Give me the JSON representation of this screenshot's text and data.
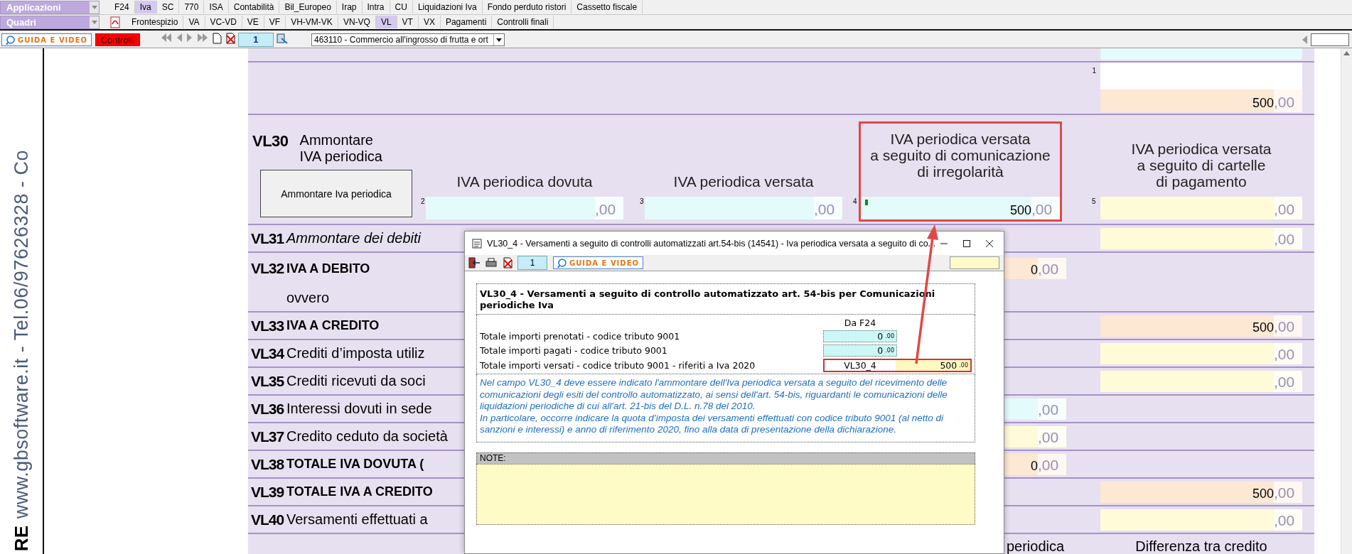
{
  "menu_bar": {
    "dropdown": "Applicazioni",
    "tabs": [
      {
        "label": "F24",
        "selected": false
      },
      {
        "label": "Iva",
        "selected": true
      },
      {
        "label": "SC",
        "selected": false
      },
      {
        "label": "770",
        "selected": false
      },
      {
        "label": "ISA",
        "selected": false
      },
      {
        "label": "Contabilità",
        "selected": false
      },
      {
        "label": "Bil_Europeo",
        "selected": false
      },
      {
        "label": "Irap",
        "selected": false
      },
      {
        "label": "Intra",
        "selected": false
      },
      {
        "label": "CU",
        "selected": false
      },
      {
        "label": "Liquidazioni Iva",
        "selected": false
      },
      {
        "label": "Fondo perduto ristori",
        "selected": false
      },
      {
        "label": "Cassetto fiscale",
        "selected": false
      }
    ]
  },
  "section_bar": {
    "dropdown": "Quadri",
    "tabs": [
      {
        "label": "Frontespizio",
        "selected": false
      },
      {
        "label": "VA",
        "selected": false
      },
      {
        "label": "VC-VD",
        "selected": false
      },
      {
        "label": "VE",
        "selected": false
      },
      {
        "label": "VF",
        "selected": false
      },
      {
        "label": "VH-VM-VK",
        "selected": false
      },
      {
        "label": "VN-VQ",
        "selected": false
      },
      {
        "label": "VL",
        "selected": true
      },
      {
        "label": "VT",
        "selected": false
      },
      {
        "label": "VX",
        "selected": false
      },
      {
        "label": "Pagamenti",
        "selected": false
      },
      {
        "label": "Controlli finali",
        "selected": false
      }
    ]
  },
  "toolbar": {
    "guide_button": "GUIDA E VIDEO",
    "controls_button": "Controlli",
    "page": "1",
    "activity": "463110 - Commercio all'ingrosso di frutta e ort"
  },
  "side_banner": {
    "text": "www.gbsoftware.it - Tel.06/97626328 - Co",
    "logo": "RE"
  },
  "form": {
    "top_field": {
      "number": "1",
      "value": "500",
      "decimals": ",00",
      "color": "#fde8d4"
    },
    "vl30": {
      "code": "VL30",
      "label": [
        "Ammontare",
        "IVA periodica"
      ],
      "button": "Ammontare Iva periodica",
      "columns": [
        {
          "number": "2",
          "header": [
            "IVA periodica dovuta"
          ],
          "decimals": ",00",
          "color": "#e4fbfb",
          "highlighted": false,
          "flag": false
        },
        {
          "number": "3",
          "header": [
            "IVA periodica versata"
          ],
          "decimals": ",00",
          "color": "#e4fbfb",
          "highlighted": false,
          "flag": false
        },
        {
          "number": "4",
          "header": [
            "IVA periodica versata",
            "a seguito di comunicazione",
            "di irregolarità"
          ],
          "value": "500",
          "decimals": ",00",
          "color": "#e4fbfb",
          "highlighted": true,
          "flag": true
        },
        {
          "number": "5",
          "header": [
            "IVA periodica versata",
            "a seguito di cartelle",
            "di pagamento"
          ],
          "decimals": ",00",
          "color": "#fffbd9",
          "highlighted": false,
          "flag": false
        }
      ]
    },
    "rows": [
      {
        "code": "VL31",
        "label": "Ammontare dei debiti",
        "bold": false,
        "italic": true,
        "right_field": {
          "decimals": ",00",
          "color": "#fffbd9"
        }
      },
      {
        "code": "VL32",
        "label": "IVA A DEBITO",
        "bold": true,
        "italic": false,
        "extra": "ovvero",
        "middle_field": {
          "value": "0",
          "decimals": ",00",
          "color": "#fde8d4"
        }
      },
      {
        "code": "VL33",
        "label": "IVA A CREDITO",
        "bold": true,
        "italic": false,
        "right_field": {
          "value": "500",
          "decimals": ",00",
          "color": "#fde8d4"
        }
      },
      {
        "code": "VL34",
        "label": "Crediti d’imposta utiliz",
        "bold": false,
        "italic": false,
        "right_field": {
          "decimals": ",00",
          "color": "#fffbd9"
        }
      },
      {
        "code": "VL35",
        "label": "Crediti ricevuti da soci",
        "bold": false,
        "italic": false,
        "right_field": {
          "decimals": ",00",
          "color": "#fffbd9"
        }
      },
      {
        "code": "VL36",
        "label": "Interessi dovuti in sede",
        "bold": false,
        "italic": false,
        "middle_field": {
          "decimals": ",00",
          "color": "#e4fbfb"
        }
      },
      {
        "code": "VL37",
        "label": "Credito ceduto da società",
        "bold": false,
        "italic": false,
        "middle_field": {
          "decimals": ",00",
          "color": "#fffbd9"
        }
      },
      {
        "code": "VL38",
        "label": "TOTALE IVA DOVUTA (",
        "bold": true,
        "italic": false,
        "middle_field": {
          "value": "0",
          "decimals": ",00",
          "color": "#fde8d4"
        }
      },
      {
        "code": "VL39",
        "label": "TOTALE IVA A CREDITO",
        "bold": true,
        "italic": false,
        "right_field": {
          "value": "500",
          "decimals": ",00",
          "color": "#fde8d4"
        }
      },
      {
        "code": "VL40",
        "label": "Versamenti effettuati a",
        "bold": false,
        "italic": false,
        "right_field": {
          "decimals": ",00",
          "color": "#fffbd9"
        }
      }
    ],
    "bottom_headers": [
      "periodica",
      "Differenza tra credito"
    ]
  },
  "dialog": {
    "title": "VL30_4 - Versamenti a seguito di controlli automatizzati art.54-bis (14541) - Iva periodica versata a seguito di co...",
    "page": "1",
    "guide_button": "GUIDA E VIDEO",
    "heading": "VL30_4 - Versamenti a seguito di controllo automatizzato art. 54-bis per Comunicazioni periodiche Iva",
    "column_header": "Da F24",
    "rows": [
      {
        "label": "Totale importi prenotati - codice tributo 9001",
        "value": "0",
        "decimals": ".00",
        "color": "#ccf7f7",
        "highlighted": false
      },
      {
        "label": "Totale importi pagati - codice tributo 9001",
        "value": "0",
        "decimals": ".00",
        "color": "#ccf7f7",
        "highlighted": false
      },
      {
        "label": "Totale importi versati - codice tributo 9001 - riferiti a Iva 2020",
        "field_label": "VL30_4",
        "value": "500",
        "decimals": ".00",
        "color": "#fff8c0",
        "highlighted": true
      }
    ],
    "notes": [
      "Nel campo VL30_4 deve essere indicato l'ammontare dell'Iva periodica versata a seguito del ricevimento delle comunicazioni degli esiti del controllo automatizzato, ai sensi dell'art. 54-bis, riguardanti le comunicazioni delle liquidazioni periodiche di cui all'art. 21-bis del D.L. n.78 del 2010.",
      "In particolare, occorre indicare la quota d’imposta dei versamenti effettuati con codice tributo 9001 (al netto di sanzioni e interessi) e anno di riferimento 2020, fino alla data di presentazione della dichiarazione."
    ],
    "note_label": "NOTE:"
  }
}
